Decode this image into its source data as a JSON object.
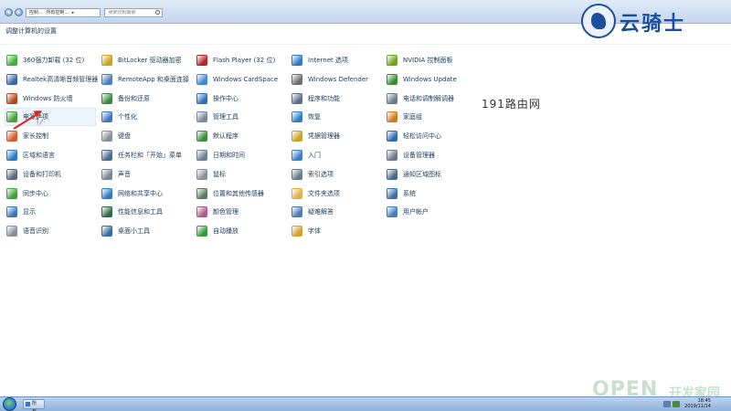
{
  "window": {
    "address_segments": [
      "控制...",
      "所有控制...",
      "▸"
    ],
    "search_placeholder": "搜索控制面板",
    "heading": "调整计算机的设置"
  },
  "watermark": {
    "brand": "云骑士",
    "annotation": "191路由网",
    "bottom_brand": "OPEN",
    "bottom_brand_cn": "开发家园"
  },
  "items": [
    {
      "label": "360强力卸载 (32 位)",
      "icon": "uninstall-icon",
      "color": "#3fae3a"
    },
    {
      "label": "BitLocker 驱动器加密",
      "icon": "bitlocker-icon",
      "color": "#c9a227"
    },
    {
      "label": "Flash Player (32 位)",
      "icon": "flash-icon",
      "color": "#b4262a"
    },
    {
      "label": "Internet 选项",
      "icon": "internet-icon",
      "color": "#2e79c5"
    },
    {
      "label": "NVIDIA 控制面板",
      "icon": "nvidia-icon",
      "color": "#6da424"
    },
    {
      "label": "Realtek高清晰音频管理器",
      "icon": "audio-icon",
      "color": "#3a66a8"
    },
    {
      "label": "RemoteApp 和桌面连接",
      "icon": "remote-icon",
      "color": "#4a7fbf"
    },
    {
      "label": "Windows CardSpace",
      "icon": "cardspace-icon",
      "color": "#3b8ad0"
    },
    {
      "label": "Windows Defender",
      "icon": "defender-icon",
      "color": "#6b6f74"
    },
    {
      "label": "Windows Update",
      "icon": "update-icon",
      "color": "#3a8e2e"
    },
    {
      "label": "Windows 防火墙",
      "icon": "firewall-icon",
      "color": "#b34a1f"
    },
    {
      "label": "备份和还原",
      "icon": "backup-icon",
      "color": "#3c8a3f"
    },
    {
      "label": "操作中心",
      "icon": "action-center-icon",
      "color": "#2f6fb8"
    },
    {
      "label": "程序和功能",
      "icon": "programs-icon",
      "color": "#5a6e8c"
    },
    {
      "label": "电话和调制解调器",
      "icon": "phone-icon",
      "color": "#6b7a8a"
    },
    {
      "label": "电源选项",
      "icon": "power-icon",
      "color": "#4a9e3a",
      "selected": true
    },
    {
      "label": "个性化",
      "icon": "personalize-icon",
      "color": "#3f78c2"
    },
    {
      "label": "管理工具",
      "icon": "admin-tools-icon",
      "color": "#7a8a9a"
    },
    {
      "label": "恢复",
      "icon": "recovery-icon",
      "color": "#2f7fc6"
    },
    {
      "label": "家庭组",
      "icon": "homegroup-icon",
      "color": "#d07a20"
    },
    {
      "label": "家长控制",
      "icon": "parental-icon",
      "color": "#d85a2a"
    },
    {
      "label": "键盘",
      "icon": "keyboard-icon",
      "color": "#8a9099"
    },
    {
      "label": "默认程序",
      "icon": "default-programs-icon",
      "color": "#3a8e3c"
    },
    {
      "label": "凭据管理器",
      "icon": "credential-icon",
      "color": "#c9a227"
    },
    {
      "label": "轻松访问中心",
      "icon": "ease-access-icon",
      "color": "#2a6cb5"
    },
    {
      "label": "区域和语言",
      "icon": "region-icon",
      "color": "#2e79c5"
    },
    {
      "label": "任务栏和「开始」菜单",
      "icon": "taskbar-icon",
      "color": "#4a6a8a"
    },
    {
      "label": "日期和时间",
      "icon": "clock-icon",
      "color": "#6e7f95"
    },
    {
      "label": "入门",
      "icon": "getting-started-icon",
      "color": "#3a7fc4"
    },
    {
      "label": "设备管理器",
      "icon": "device-manager-icon",
      "color": "#6a7a8a"
    },
    {
      "label": "设备和打印机",
      "icon": "printer-icon",
      "color": "#5a6a7a"
    },
    {
      "label": "声音",
      "icon": "sound-icon",
      "color": "#7a8590"
    },
    {
      "label": "鼠标",
      "icon": "mouse-icon",
      "color": "#8a9099"
    },
    {
      "label": "索引选项",
      "icon": "index-icon",
      "color": "#6a7a8a"
    },
    {
      "label": "通知区域图标",
      "icon": "notification-icon",
      "color": "#4a6a8a"
    },
    {
      "label": "同步中心",
      "icon": "sync-icon",
      "color": "#3aa33a"
    },
    {
      "label": "网络和共享中心",
      "icon": "network-icon",
      "color": "#2e79c5"
    },
    {
      "label": "位置和其他传感器",
      "icon": "sensor-icon",
      "color": "#5a7a5a"
    },
    {
      "label": "文件夹选项",
      "icon": "folder-icon",
      "color": "#e0b040"
    },
    {
      "label": "系统",
      "icon": "system-icon",
      "color": "#3b6fae"
    },
    {
      "label": "显示",
      "icon": "display-icon",
      "color": "#3a78c4"
    },
    {
      "label": "性能信息和工具",
      "icon": "performance-icon",
      "color": "#2f6a4a"
    },
    {
      "label": "颜色管理",
      "icon": "color-icon",
      "color": "#b05a8a"
    },
    {
      "label": "疑难解答",
      "icon": "troubleshoot-icon",
      "color": "#4a7ab8"
    },
    {
      "label": "用户帐户",
      "icon": "user-accounts-icon",
      "color": "#3f7fc2"
    },
    {
      "label": "语音识别",
      "icon": "speech-icon",
      "color": "#8a9099"
    },
    {
      "label": "桌面小工具",
      "icon": "gadgets-icon",
      "color": "#3a6aa8"
    },
    {
      "label": "自动播放",
      "icon": "autoplay-icon",
      "color": "#3a9a3a"
    },
    {
      "label": "字体",
      "icon": "fonts-icon",
      "color": "#d0a030"
    }
  ],
  "taskbar": {
    "task_label": "所有...",
    "time": "18:45",
    "date": "2019/11/14"
  }
}
